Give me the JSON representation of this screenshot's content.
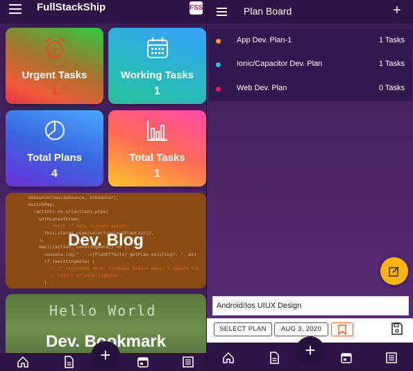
{
  "left": {
    "app_title": "FullStackShip",
    "logo_text": "FSS",
    "tiles": [
      {
        "label": "Urgent Tasks",
        "count": "1",
        "icon": "alarm-clock-icon"
      },
      {
        "label": "Working Tasks",
        "count": "1",
        "icon": "calendar-icon"
      },
      {
        "label": "Total Plans",
        "count": "4",
        "icon": "pie-chart-icon"
      },
      {
        "label": "Total Tasks",
        "count": "1",
        "icon": "bar-chart-icon"
      }
    ],
    "blog": {
      "title": "Dev. Blog"
    },
    "bookmark": {
      "title": "Dev. Bookmark",
      "image_text": "Hello World"
    },
    "nav": [
      "home-icon",
      "document-icon",
      "add-icon",
      "calendar-icon",
      "list-icon"
    ]
  },
  "right": {
    "page_title": "Plan Board",
    "plans": [
      {
        "name": "App Dev. Plan-1",
        "tasks": "1 Tasks",
        "color": "#ff9800"
      },
      {
        "name": "Ionic/Capacitor Dev. Plan",
        "tasks": "1 Tasks",
        "color": "#26c6da"
      },
      {
        "name": "Web Dev. Plan",
        "tasks": "0 Tasks",
        "color": "#e91e63"
      }
    ],
    "task_input_value": "Android/Ios UIUX Design",
    "select_plan_label": "SELECT PLAN",
    "date_label": "AUG 3, 2020",
    "colors": {
      "accent_fab": "#f6b415",
      "bookmark_chip": "#f05a2a"
    }
  }
}
